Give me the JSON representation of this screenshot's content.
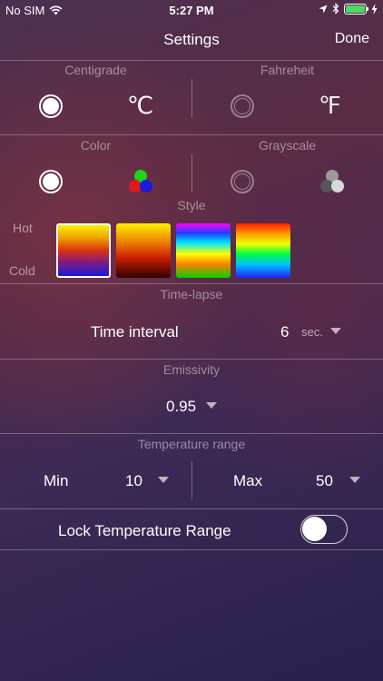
{
  "status_bar": {
    "carrier": "No SIM",
    "time": "5:27 PM",
    "icons": [
      "wifi-icon",
      "location-icon",
      "bluetooth-icon",
      "battery-icon",
      "charging-icon"
    ]
  },
  "nav": {
    "title": "Settings",
    "done_label": "Done"
  },
  "temperature_unit": {
    "celsius_label": "Centigrade",
    "celsius_symbol": "℃",
    "celsius_selected": true,
    "fahrenheit_label": "Fahreheit",
    "fahrenheit_symbol": "℉",
    "fahrenheit_selected": false
  },
  "color_mode": {
    "color_label": "Color",
    "color_selected": true,
    "grayscale_label": "Grayscale",
    "grayscale_selected": false
  },
  "style": {
    "label": "Style",
    "hot_label": "Hot",
    "cold_label": "Cold",
    "palettes": [
      {
        "name": "hot-to-blue",
        "selected": true
      },
      {
        "name": "yellow-to-black",
        "selected": false
      },
      {
        "name": "rainbow-magenta",
        "selected": false
      },
      {
        "name": "rainbow-blue",
        "selected": false
      }
    ]
  },
  "time_lapse": {
    "label": "Time-lapse",
    "interval_label": "Time interval",
    "interval_value": "6",
    "interval_unit": "sec."
  },
  "emissivity": {
    "label": "Emissivity",
    "value": "0.95"
  },
  "temperature_range": {
    "label": "Temperature range",
    "min_label": "Min",
    "min_value": "10",
    "max_label": "Max",
    "max_value": "50"
  },
  "lock_range": {
    "label": "Lock Temperature Range",
    "enabled": false
  }
}
